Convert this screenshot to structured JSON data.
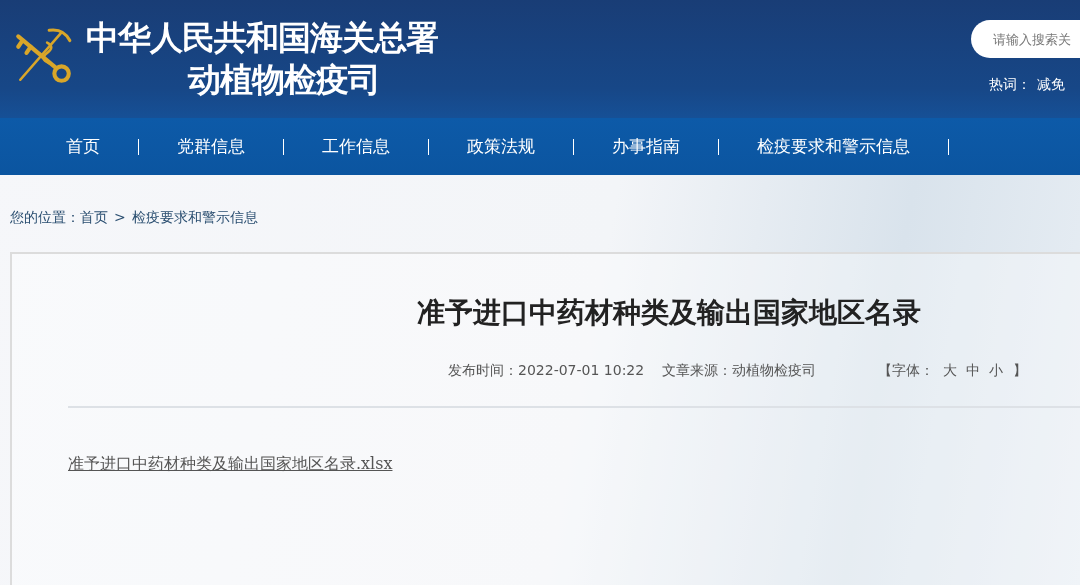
{
  "header": {
    "title": "中华人民共和国海关总署",
    "subtitle": "动植物检疫司",
    "search": {
      "placeholder": "请输入搜索关"
    },
    "hot_words": {
      "label": "热词：",
      "items": [
        "减免"
      ]
    }
  },
  "nav": {
    "items": [
      {
        "label": "首页"
      },
      {
        "label": "党群信息"
      },
      {
        "label": "工作信息"
      },
      {
        "label": "政策法规"
      },
      {
        "label": "办事指南"
      },
      {
        "label": "检疫要求和警示信息"
      }
    ]
  },
  "breadcrumb": {
    "label": "您的位置：",
    "items": [
      "首页",
      "检疫要求和警示信息"
    ],
    "separator": ">"
  },
  "article": {
    "title": "准予进口中药材种类及输出国家地区名录",
    "published": "发布时间：2022-07-01 10:22",
    "source": "文章来源：动植物检疫司",
    "font_size": {
      "open": "【字体：",
      "options": [
        "大",
        "中",
        "小"
      ],
      "close": "】"
    },
    "attachments": [
      "准予进口中药材种类及输出国家地区名录.xlsx"
    ]
  }
}
